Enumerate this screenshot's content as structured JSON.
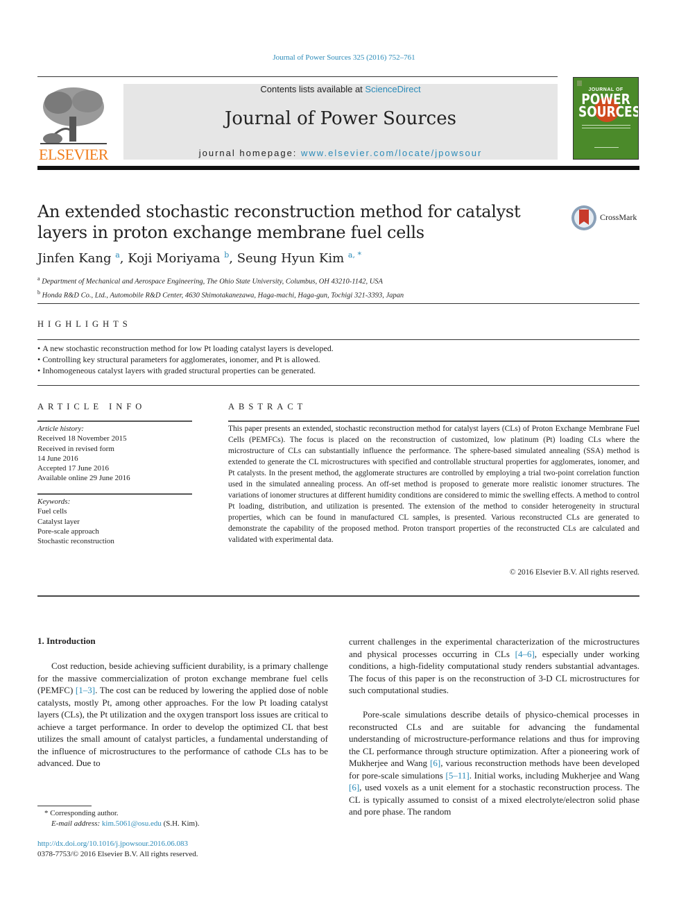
{
  "header": {
    "citation": "Journal of Power Sources 325 (2016) 752–761",
    "publisher_logo_text": "ELSEVIER",
    "contents_prefix": "Contents lists available at ",
    "contents_link": "ScienceDirect",
    "journal_title": "Journal of Power Sources",
    "homepage_prefix": "journal homepage: ",
    "homepage_link": "www.elsevier.com/locate/jpowsour",
    "cover": {
      "line1": "JOURNAL OF",
      "line2": "POWER",
      "line3": "SOURCES",
      "background_color": "#4b8a2a",
      "accent_color": "#d04a1e"
    }
  },
  "article": {
    "title": "An extended stochastic reconstruction method for catalyst layers in proton exchange membrane fuel cells",
    "crossmark_label": "CrossMark",
    "authors": [
      {
        "name": "Jinfen Kang",
        "sup": "a"
      },
      {
        "name": "Koji Moriyama",
        "sup": "b"
      },
      {
        "name": "Seung Hyun Kim",
        "sup": "a, *"
      }
    ],
    "affiliations": [
      {
        "sup": "a",
        "text": "Department of Mechanical and Aerospace Engineering, The Ohio State University, Columbus, OH 43210-1142, USA"
      },
      {
        "sup": "b",
        "text": "Honda R&D Co., Ltd., Automobile R&D Center, 4630 Shimotakanezawa, Haga-machi, Haga-gun, Tochigi 321-3393, Japan"
      }
    ]
  },
  "highlights": {
    "heading": "HIGHLIGHTS",
    "items": [
      "A new stochastic reconstruction method for low Pt loading catalyst layers is developed.",
      "Controlling key structural parameters for agglomerates, ionomer, and Pt is allowed.",
      "Inhomogeneous catalyst layers with graded structural properties can be generated."
    ]
  },
  "article_info": {
    "heading": "ARTICLE INFO",
    "history_label": "Article history:",
    "history": [
      "Received 18 November 2015",
      "Received in revised form",
      "14 June 2016",
      "Accepted 17 June 2016",
      "Available online 29 June 2016"
    ],
    "keywords_label": "Keywords:",
    "keywords": [
      "Fuel cells",
      "Catalyst layer",
      "Pore-scale approach",
      "Stochastic reconstruction"
    ]
  },
  "abstract": {
    "heading": "ABSTRACT",
    "text": "This paper presents an extended, stochastic reconstruction method for catalyst layers (CLs) of Proton Exchange Membrane Fuel Cells (PEMFCs). The focus is placed on the reconstruction of customized, low platinum (Pt) loading CLs where the microstructure of CLs can substantially influence the performance. The sphere-based simulated annealing (SSA) method is extended to generate the CL microstructures with specified and controllable structural properties for agglomerates, ionomer, and Pt catalysts. In the present method, the agglomerate structures are controlled by employing a trial two-point correlation function used in the simulated annealing process. An off-set method is proposed to generate more realistic ionomer structures. The variations of ionomer structures at different humidity conditions are considered to mimic the swelling effects. A method to control Pt loading, distribution, and utilization is presented. The extension of the method to consider heterogeneity in structural properties, which can be found in manufactured CL samples, is presented. Various reconstructed CLs are generated to demonstrate the capability of the proposed method. Proton transport properties of the reconstructed CLs are calculated and validated with experimental data.",
    "copyright": "© 2016 Elsevier B.V. All rights reserved."
  },
  "body": {
    "section_heading": "1.  Introduction",
    "left_para": [
      "Cost reduction, beside achieving sufficient durability, is a primary challenge for the massive commercialization of proton exchange membrane fuel cells (PEMFC) ",
      "[1–3]",
      ". The cost can be reduced by lowering the applied dose of noble catalysts, mostly Pt, among other approaches. For the low Pt loading catalyst layers (CLs), the Pt utilization and the oxygen transport loss issues are critical to achieve a target performance. In order to develop the optimized CL that best utilizes the small amount of catalyst particles, a fundamental understanding of the influence of microstructures to the performance of cathode CLs has to be advanced. Due to"
    ],
    "right_para1": [
      "current challenges in the experimental characterization of the microstructures and physical processes occurring in CLs ",
      "[4–6]",
      ", especially under working conditions, a high-fidelity computational study renders substantial advantages. The focus of this paper is on the reconstruction of 3-D CL microstructures for such computational studies."
    ],
    "right_para2": [
      "Pore-scale simulations describe details of physico-chemical processes in reconstructed CLs and are suitable for advancing the fundamental understanding of microstructure-performance relations and thus for improving the CL performance through structure optimization. After a pioneering work of Mukherjee and Wang ",
      "[6]",
      ", various reconstruction methods have been developed for pore-scale simulations ",
      "[5–11]",
      ". Initial works, including Mukherjee and Wang ",
      "[6]",
      ", used voxels as a unit element for a stochastic reconstruction process. The CL is typically assumed to consist of a mixed electrolyte/electron solid phase and pore phase. The random"
    ]
  },
  "footnotes": {
    "corresponding": "* Corresponding author.",
    "email_label": "E-mail address: ",
    "email": "kim.5061@osu.edu",
    "email_suffix": " (S.H. Kim).",
    "doi": "http://dx.doi.org/10.1016/j.jpowsour.2016.06.083",
    "issn": "0378-7753/© 2016 Elsevier B.V. All rights reserved."
  },
  "colors": {
    "link": "#2a8ab8",
    "elsevier_orange": "#f07c1a",
    "header_band": "#e6e6e6"
  }
}
